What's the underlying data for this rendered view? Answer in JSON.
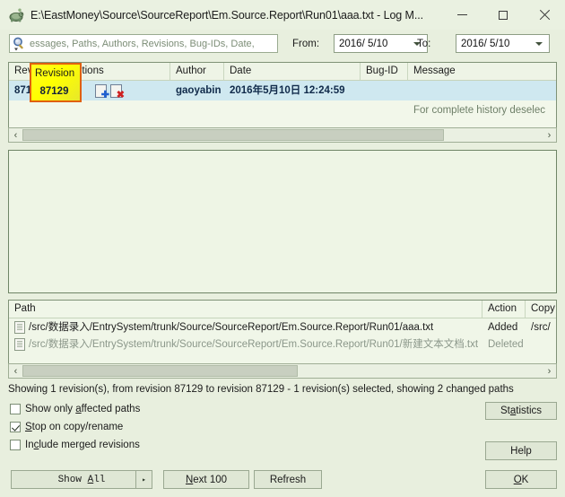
{
  "window": {
    "title": "E:\\EastMoney\\Source\\SourceReport\\Em.Source.Report\\Run01\\aaa.txt - Log M...",
    "icon": "tortoise-svn-icon",
    "minimize_label": "Minimize",
    "maximize_label": "Maximize",
    "close_label": "Close"
  },
  "filters": {
    "search_placeholder": "essages, Paths, Authors, Revisions, Bug-IDs, Date,",
    "search_value": "",
    "search_icon": "search-icon",
    "from_label": "From:",
    "from_value": "2016/ 5/10",
    "to_label": "To:",
    "to_value": "2016/ 5/10"
  },
  "log_table": {
    "columns": [
      "Revision",
      "Actions",
      "Author",
      "Date",
      "Bug-ID",
      "Message"
    ],
    "rows": [
      {
        "revision": "87129",
        "actions": [
          "file-added-icon",
          "file-deleted-icon"
        ],
        "author": "gaoyabin",
        "date": "2016年5月10日 12:24:59",
        "bug_id": "",
        "message": "",
        "selected": true
      }
    ],
    "footer_note": "For complete history deselec",
    "scrollbar": {
      "left_arrow": "‹",
      "right_arrow": "›",
      "thumb_start_pct": 2,
      "thumb_width_pct": 80
    }
  },
  "highlight": {
    "header_label": "Revision",
    "value_label": "87129",
    "fill_color": "#ffff00",
    "border_color": "#e06010"
  },
  "message_panel": {
    "text": ""
  },
  "path_table": {
    "columns": [
      "Path",
      "Action",
      "Copy"
    ],
    "rows": [
      {
        "path": "/src/数据录入/EntrySystem/trunk/Source/SourceReport/Em.Source.Report/Run01/aaa.txt",
        "action": "Added",
        "copy": "/src/",
        "state": "added",
        "icon": "file-icon"
      },
      {
        "path": "/src/数据录入/EntrySystem/trunk/Source/SourceReport/Em.Source.Report/Run01/新建文本文档.txt",
        "action": "Deleted",
        "copy": "",
        "state": "deleted",
        "icon": "file-icon"
      }
    ],
    "scrollbar": {
      "left_arrow": "‹",
      "right_arrow": "›",
      "thumb_start_pct": 2,
      "thumb_width_pct": 51
    }
  },
  "status": {
    "text": "Showing 1 revision(s), from revision 87129 to revision 87129 - 1 revision(s) selected, showing 2 changed paths"
  },
  "options": [
    {
      "label_pre": "Show only ",
      "label_key": "a",
      "label_post": "ffected paths",
      "checked": false
    },
    {
      "label_pre": "",
      "label_key": "S",
      "label_post": "top on copy/rename",
      "checked": true
    },
    {
      "label_pre": "In",
      "label_key": "c",
      "label_post": "lude merged revisions",
      "checked": false
    }
  ],
  "buttons": {
    "statistics": "Statistics",
    "help": "Help",
    "ok": "OK",
    "show_all": "Show All",
    "show_all_arrow": "▸",
    "next_100": "Next 100",
    "refresh": "Refresh"
  }
}
